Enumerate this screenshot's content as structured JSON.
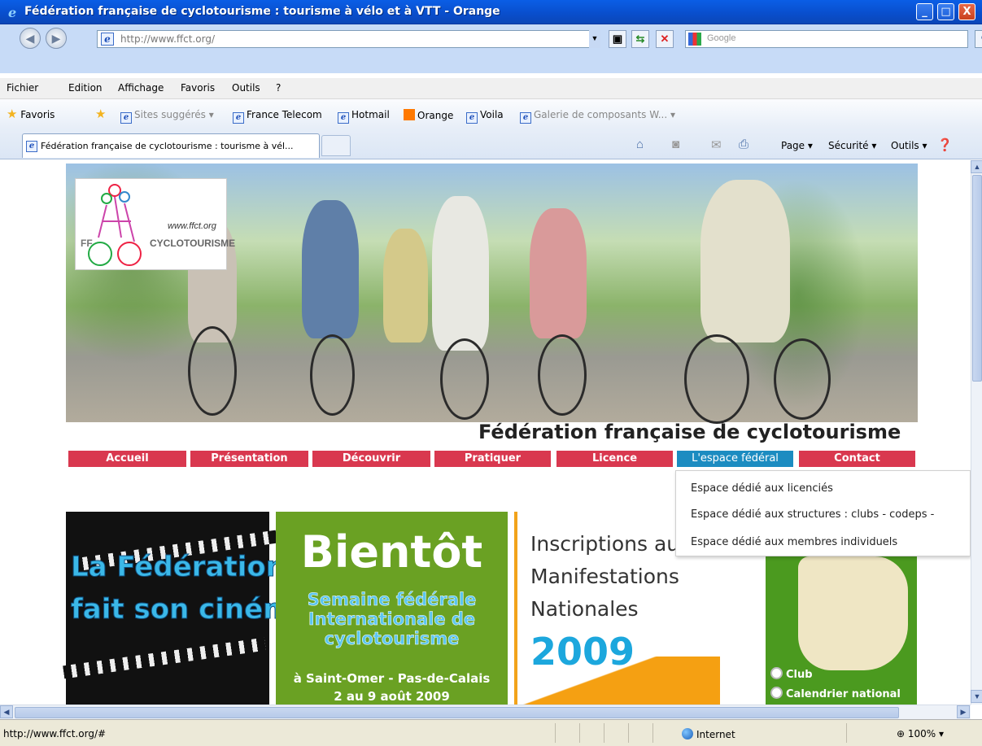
{
  "window": {
    "title": "Fédération française de cyclotourisme : tourisme à vélo et à VTT - Orange",
    "minimize": "_",
    "maximize": "□",
    "close": "X"
  },
  "address": {
    "url": "http://www.ffct.org/"
  },
  "search": {
    "placeholder": "Google"
  },
  "menu": [
    "Fichier",
    "Edition",
    "Affichage",
    "Favoris",
    "Outils",
    "?"
  ],
  "favorites": {
    "label": "Favoris",
    "items": [
      {
        "label": "Sites suggérés ▾",
        "dim": true
      },
      {
        "label": "France Telecom",
        "dim": false
      },
      {
        "label": "Hotmail",
        "dim": false
      },
      {
        "label": "Orange",
        "dim": false
      },
      {
        "label": "Voila",
        "dim": false
      },
      {
        "label": "Galerie de composants W... ▾",
        "dim": true
      }
    ]
  },
  "tab": {
    "label": "Fédération française de cyclotourisme : tourisme à vél..."
  },
  "commands": {
    "page": "Page ▾",
    "security": "Sécurité ▾",
    "tools": "Outils ▾"
  },
  "site": {
    "logo_url": "www.ffct.org",
    "logo_ff": "FF",
    "logo_name": "CYCLOTOURISME",
    "heading": "Fédération française de cyclotourisme",
    "nav": [
      "Accueil",
      "Présentation",
      "Découvrir",
      "Pratiquer",
      "Licence",
      "L'espace fédéral",
      "Contact"
    ],
    "active_nav": "L'espace fédéral",
    "dropdown": [
      "Espace dédié aux licenciés",
      "Espace dédié aux structures : clubs - codeps -",
      "Espace dédié aux membres individuels"
    ],
    "promo_cinema": {
      "line1": "La Fédération",
      "line2": "fait son cinéma"
    },
    "promo_semaine": {
      "big": "Bientôt",
      "line1": "Semaine fédérale",
      "line2": "Internationale de",
      "line3": "cyclotourisme",
      "place": "à Saint-Omer - Pas-de-Calais",
      "dates": "2 au 9 août 2009"
    },
    "promo_inscriptions": {
      "line1": "Inscriptions aux",
      "line2": "Manifestations",
      "line3": "Nationales",
      "year": "2009"
    },
    "map_links": [
      "Club",
      "Calendrier national"
    ]
  },
  "status": {
    "text": "http://www.ffct.org/#",
    "zone": "Internet",
    "zoom": "100%"
  },
  "colors": {
    "nav_red": "#d9384f",
    "nav_active": "#1c8cc1",
    "ie_titlebar": "#0a5ee6"
  }
}
